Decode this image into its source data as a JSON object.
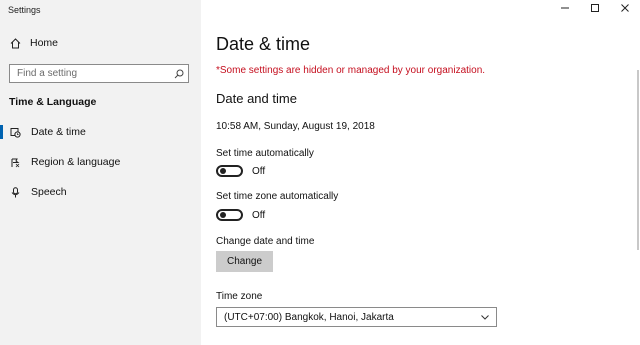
{
  "window": {
    "title": "Settings"
  },
  "sidebar": {
    "home_label": "Home",
    "search_placeholder": "Find a setting",
    "section_title": "Time & Language",
    "items": [
      {
        "label": "Date & time",
        "icon": "date-time-icon",
        "active": true
      },
      {
        "label": "Region & language",
        "icon": "region-language-icon",
        "active": false
      },
      {
        "label": "Speech",
        "icon": "microphone-icon",
        "active": false
      }
    ]
  },
  "main": {
    "title": "Date & time",
    "policy_note": "*Some settings are hidden or managed by your organization.",
    "subhead": "Date and time",
    "current_datetime": "10:58 AM, Sunday, August 19, 2018",
    "set_time_auto": {
      "label": "Set time automatically",
      "state": "Off"
    },
    "set_timezone_auto": {
      "label": "Set time zone automatically",
      "state": "Off"
    },
    "change_label": "Change date and time",
    "change_button": "Change",
    "timezone_label": "Time zone",
    "timezone_value": "(UTC+07:00) Bangkok, Hanoi, Jakarta"
  },
  "colors": {
    "accent": "#0063b1",
    "policy_red": "#c50f1f",
    "sidebar_bg": "#f2f2f2",
    "button_bg": "#cccccc"
  }
}
